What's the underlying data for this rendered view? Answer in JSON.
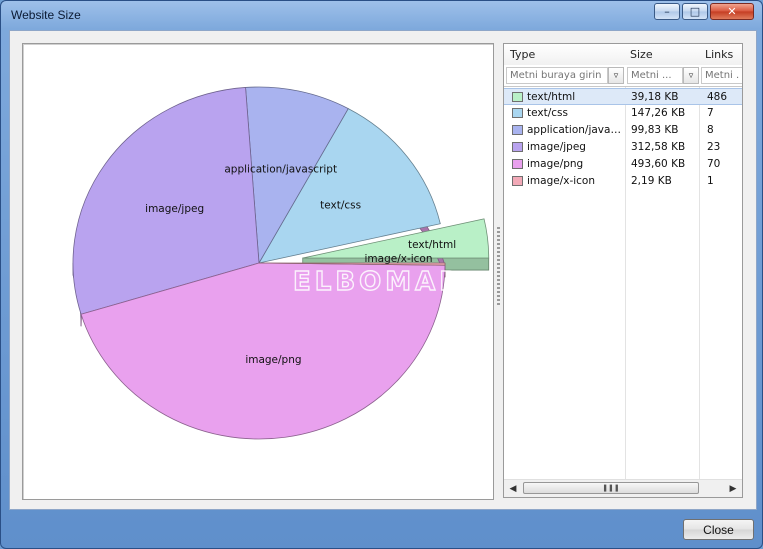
{
  "window": {
    "title": "Website Size",
    "minimize_icon": "minimize-icon",
    "maximize_icon": "maximize-icon",
    "close_icon": "close-icon"
  },
  "grid": {
    "columns": [
      {
        "label": "Type",
        "filter_placeholder": "Metni buraya girin"
      },
      {
        "label": "Size",
        "filter_placeholder": "Metni ..."
      },
      {
        "label": "Links",
        "filter_placeholder": "Metni ..."
      }
    ],
    "rows": [
      {
        "type": "text/html",
        "size": "39,18 KB",
        "links": "486",
        "color": "#b9f0c7"
      },
      {
        "type": "text/css",
        "size": "147,26 KB",
        "links": "7",
        "color": "#a9d6f0"
      },
      {
        "type": "application/javas...",
        "size": "99,83 KB",
        "links": "8",
        "color": "#a9b3ef"
      },
      {
        "type": "image/jpeg",
        "size": "312,58 KB",
        "links": "23",
        "color": "#b9a3ef"
      },
      {
        "type": "image/png",
        "size": "493,60 KB",
        "links": "70",
        "color": "#e9a1ee"
      },
      {
        "type": "image/x-icon",
        "size": "2,19 KB",
        "links": "1",
        "color": "#f2a9b7"
      }
    ],
    "selected_row": 0
  },
  "chart_data": {
    "type": "pie",
    "title": "",
    "categories": [
      "text/html",
      "text/css",
      "application/javascript",
      "image/jpeg",
      "image/png",
      "image/x-icon"
    ],
    "values": [
      39.18,
      147.26,
      99.83,
      312.58,
      493.6,
      2.19
    ],
    "unit": "KB",
    "exploded": "text/html",
    "colors": [
      "#b9f0c7",
      "#a9d6f0",
      "#a9b3ef",
      "#b9a3ef",
      "#e9a1ee",
      "#f2a9b7"
    ],
    "watermark": "ELBOMAR"
  },
  "buttons": {
    "close": "Close"
  }
}
